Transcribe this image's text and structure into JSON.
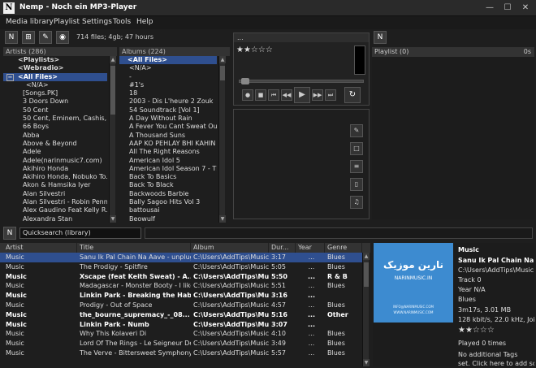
{
  "window": {
    "title": "Nemp - Noch ein MP3-Player",
    "icon_letter": "N"
  },
  "menu": [
    "Media library",
    "Playlist",
    "Settings",
    "Tools",
    "Help"
  ],
  "toolbar": {
    "stats": "714 files; 4gb; 47 hours"
  },
  "artists": {
    "header": "Artists (286)",
    "items": [
      "<Playlists>",
      "<Webradio>",
      "<All Files>",
      "<N/A>",
      "[Songs.PK]",
      "3 Doors Down",
      "50 Cent",
      "50 Cent, Eminem, Cashis, ...",
      "66 Boys",
      "Abba",
      "Above & Beyond",
      "Adele",
      "Adele(narinmusic7.com)",
      "Akihiro Honda",
      "Akihiro Honda, Nobuko To...",
      "Akon & Hamsika Iyer",
      "Alan Silvestri",
      "Alan Silvestri - Robin Penn...",
      "Alex Gaudino Feat Kelly R...",
      "Alexandra Stan"
    ]
  },
  "albums": {
    "header": "Albums (224)",
    "items": [
      "<All Files>",
      "<N/A>",
      "-",
      "#1's",
      "18",
      "2003 - Dis L'heure 2 Zouk",
      "54 Soundtrack [Vol 1]",
      "A Day Without Rain",
      "A Fever You Cant Sweat Out",
      "A Thousand Suns",
      "AAP KO PEHLAY BHI KAHIN ...",
      "All The Right Reasons",
      "American Idol 5",
      "American Idol Season 7 - The",
      "Back To Basics",
      "Back To Black",
      "Backwoods Barbie",
      "Bally Sagoo Hits Vol 3",
      "battousai",
      "Beowulf"
    ]
  },
  "player": {
    "title": "...",
    "rating": "★★☆☆☆"
  },
  "playlist": {
    "label": "Playlist (0)",
    "duration": "0s"
  },
  "search": {
    "value": "Quicksearch (library)"
  },
  "table": {
    "headers": [
      "Artist",
      "Title",
      "Album",
      "Dur...",
      "Year",
      "Genre"
    ],
    "rows": [
      {
        "artist": "Music",
        "title": "Sanu Ik Pal Chain Na Aave - unplug...",
        "album": "C:\\Users\\AddTips\\Music",
        "dur": "3:17",
        "year": "...",
        "genre": "Blues",
        "bold": false,
        "selected": true
      },
      {
        "artist": "Music",
        "title": "The Prodigy - Spitfire",
        "album": "C:\\Users\\AddTips\\Music",
        "dur": "5:05",
        "year": "...",
        "genre": "Blues",
        "bold": false,
        "selected": false
      },
      {
        "artist": "Music",
        "title": "Xscape (feat Keith Sweat) - A...",
        "album": "C:\\Users\\AddTips\\Music",
        "dur": "5:50",
        "year": "...",
        "genre": "R & B",
        "bold": true,
        "selected": false
      },
      {
        "artist": "Music",
        "title": "Madagascar - Monster Booty - I like...",
        "album": "C:\\Users\\AddTips\\Music",
        "dur": "5:51",
        "year": "...",
        "genre": "Blues",
        "bold": false,
        "selected": false
      },
      {
        "artist": "Music",
        "title": "Linkin Park - Breaking the Habit",
        "album": "C:\\Users\\AddTips\\Music",
        "dur": "3:16",
        "year": "...",
        "genre": "",
        "bold": true,
        "selected": false
      },
      {
        "artist": "Music",
        "title": "Prodigy - Out of Space",
        "album": "C:\\Users\\AddTips\\Music",
        "dur": "4:57",
        "year": "...",
        "genre": "Blues",
        "bold": false,
        "selected": false
      },
      {
        "artist": "Music",
        "title": "the_bourne_supremacy_-_08...",
        "album": "C:\\Users\\AddTips\\Music",
        "dur": "5:16",
        "year": "...",
        "genre": "Other",
        "bold": true,
        "selected": false
      },
      {
        "artist": "Music",
        "title": "Linkin Park -  Numb",
        "album": "C:\\Users\\AddTips\\Music",
        "dur": "3:07",
        "year": "...",
        "genre": "",
        "bold": true,
        "selected": false
      },
      {
        "artist": "Music",
        "title": "Why This Kolaveri Di",
        "album": "C:\\Users\\AddTips\\Music",
        "dur": "4:10",
        "year": "...",
        "genre": "Blues",
        "bold": false,
        "selected": false
      },
      {
        "artist": "Music",
        "title": "Lord Of The Rings - Le Seigneur De...",
        "album": "C:\\Users\\AddTips\\Music",
        "dur": "3:49",
        "year": "...",
        "genre": "Blues",
        "bold": false,
        "selected": false
      },
      {
        "artist": "Music",
        "title": "The Verve - Bittersweet Symphony",
        "album": "C:\\Users\\AddTips\\Music",
        "dur": "5:57",
        "year": "...",
        "genre": "Blues",
        "bold": false,
        "selected": false
      }
    ]
  },
  "info": {
    "artist": "Music",
    "title": "Sanu Ik Pal Chain Na",
    "path": "C:\\Users\\AddTips\\Music",
    "track": "Track 0",
    "year": "Year N/A",
    "genre": "Blues",
    "length": "3m17s, 3.01 MB",
    "bitrate": "128 kbit/s, 22.0 kHz, Joint",
    "rating": "★★☆☆☆",
    "played": "Played 0 times",
    "tags": "No additional Tags",
    "tags2": "set. Click here to add some.",
    "cover_logo": "نارین موزیک",
    "cover_url": "NARINMUSIC.IN",
    "cover_email": "INFO@NARINMUSIC.COM",
    "cover_site": "WWW.NARINMUSIC.COM"
  },
  "colors": {
    "selection": "#2f4f8f",
    "cover": "#3d8bd0",
    "background": "#1e1e1e"
  }
}
